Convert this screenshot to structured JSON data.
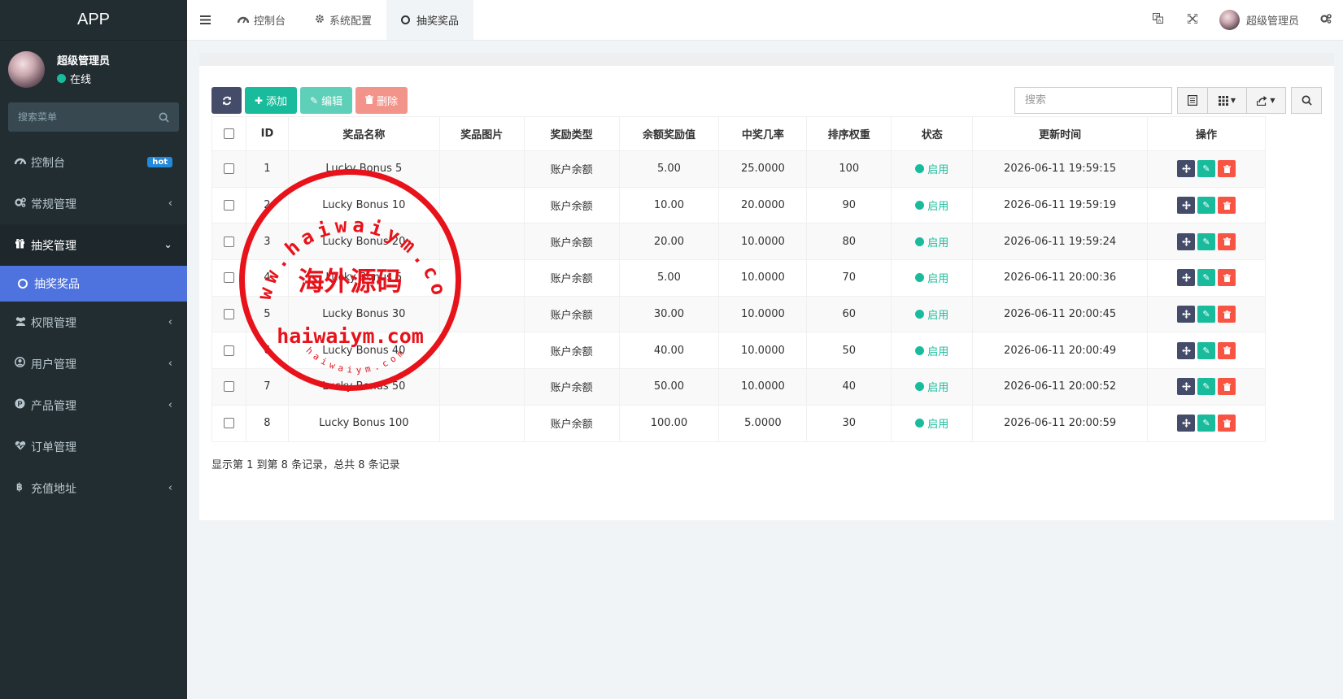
{
  "app_title": "APP",
  "user": {
    "name": "超级管理员",
    "status": "在线"
  },
  "sidebar": {
    "search_placeholder": "搜索菜单",
    "items": [
      {
        "label": "控制台",
        "badge": "hot",
        "icon": "dashboard-icon"
      },
      {
        "label": "常规管理",
        "icon": "cogs-icon"
      },
      {
        "label": "抽奖管理",
        "icon": "gift-icon",
        "open": true
      },
      {
        "label": "抽奖奖品",
        "icon": "circle-icon",
        "active": true,
        "sub": true
      },
      {
        "label": "权限管理",
        "icon": "group-icon"
      },
      {
        "label": "用户管理",
        "icon": "user-circle-icon"
      },
      {
        "label": "产品管理",
        "icon": "product-icon"
      },
      {
        "label": "订单管理",
        "icon": "heartbeat-icon"
      },
      {
        "label": "充值地址",
        "icon": "bitcoin-icon"
      }
    ]
  },
  "header": {
    "tabs": [
      {
        "label": "控制台",
        "icon": "dashboard-icon"
      },
      {
        "label": "系统配置",
        "icon": "gear-icon"
      },
      {
        "label": "抽奖奖品",
        "icon": "circle-icon",
        "active": true
      }
    ],
    "username": "超级管理员"
  },
  "toolbar": {
    "add_label": "添加",
    "edit_label": "编辑",
    "delete_label": "删除",
    "search_placeholder": "搜索"
  },
  "table": {
    "columns": [
      "ID",
      "奖品名称",
      "奖品图片",
      "奖励类型",
      "余额奖励值",
      "中奖几率",
      "排序权重",
      "状态",
      "更新时间",
      "操作"
    ],
    "rows": [
      {
        "id": "1",
        "name": "Lucky Bonus 5",
        "image": "",
        "type": "账户余额",
        "value": "5.00",
        "rate": "25.0000",
        "weight": "100",
        "status": "启用",
        "updated": "2026-06-11 19:59:15"
      },
      {
        "id": "2",
        "name": "Lucky Bonus 10",
        "image": "",
        "type": "账户余额",
        "value": "10.00",
        "rate": "20.0000",
        "weight": "90",
        "status": "启用",
        "updated": "2026-06-11 19:59:19"
      },
      {
        "id": "3",
        "name": "Lucky Bonus 20",
        "image": "",
        "type": "账户余额",
        "value": "20.00",
        "rate": "10.0000",
        "weight": "80",
        "status": "启用",
        "updated": "2026-06-11 19:59:24"
      },
      {
        "id": "4",
        "name": "Lucky Bonus 5",
        "image": "",
        "type": "账户余额",
        "value": "5.00",
        "rate": "10.0000",
        "weight": "70",
        "status": "启用",
        "updated": "2026-06-11 20:00:36"
      },
      {
        "id": "5",
        "name": "Lucky Bonus 30",
        "image": "",
        "type": "账户余额",
        "value": "30.00",
        "rate": "10.0000",
        "weight": "60",
        "status": "启用",
        "updated": "2026-06-11 20:00:45"
      },
      {
        "id": "6",
        "name": "Lucky Bonus 40",
        "image": "",
        "type": "账户余额",
        "value": "40.00",
        "rate": "10.0000",
        "weight": "50",
        "status": "启用",
        "updated": "2026-06-11 20:00:49"
      },
      {
        "id": "7",
        "name": "Lucky Bonus 50",
        "image": "",
        "type": "账户余额",
        "value": "50.00",
        "rate": "10.0000",
        "weight": "40",
        "status": "启用",
        "updated": "2026-06-11 20:00:52"
      },
      {
        "id": "8",
        "name": "Lucky Bonus 100",
        "image": "",
        "type": "账户余额",
        "value": "100.00",
        "rate": "5.0000",
        "weight": "30",
        "status": "启用",
        "updated": "2026-06-11 20:00:59"
      }
    ]
  },
  "pagination_info": "显示第 1 到第 8 条记录，总共 8 条记录",
  "watermark": {
    "arc_text": "www.haiwaiym.com",
    "center_text": "海外源码",
    "domain_text": "haiwaiym.com",
    "small_text": "haiwaiym.com"
  },
  "colors": {
    "sidebar_bg": "#222d32",
    "active_menu": "#4e73df",
    "success": "#18bc9c",
    "danger": "#f75444",
    "dark_btn": "#444c69",
    "watermark_red": "#e8121a"
  }
}
